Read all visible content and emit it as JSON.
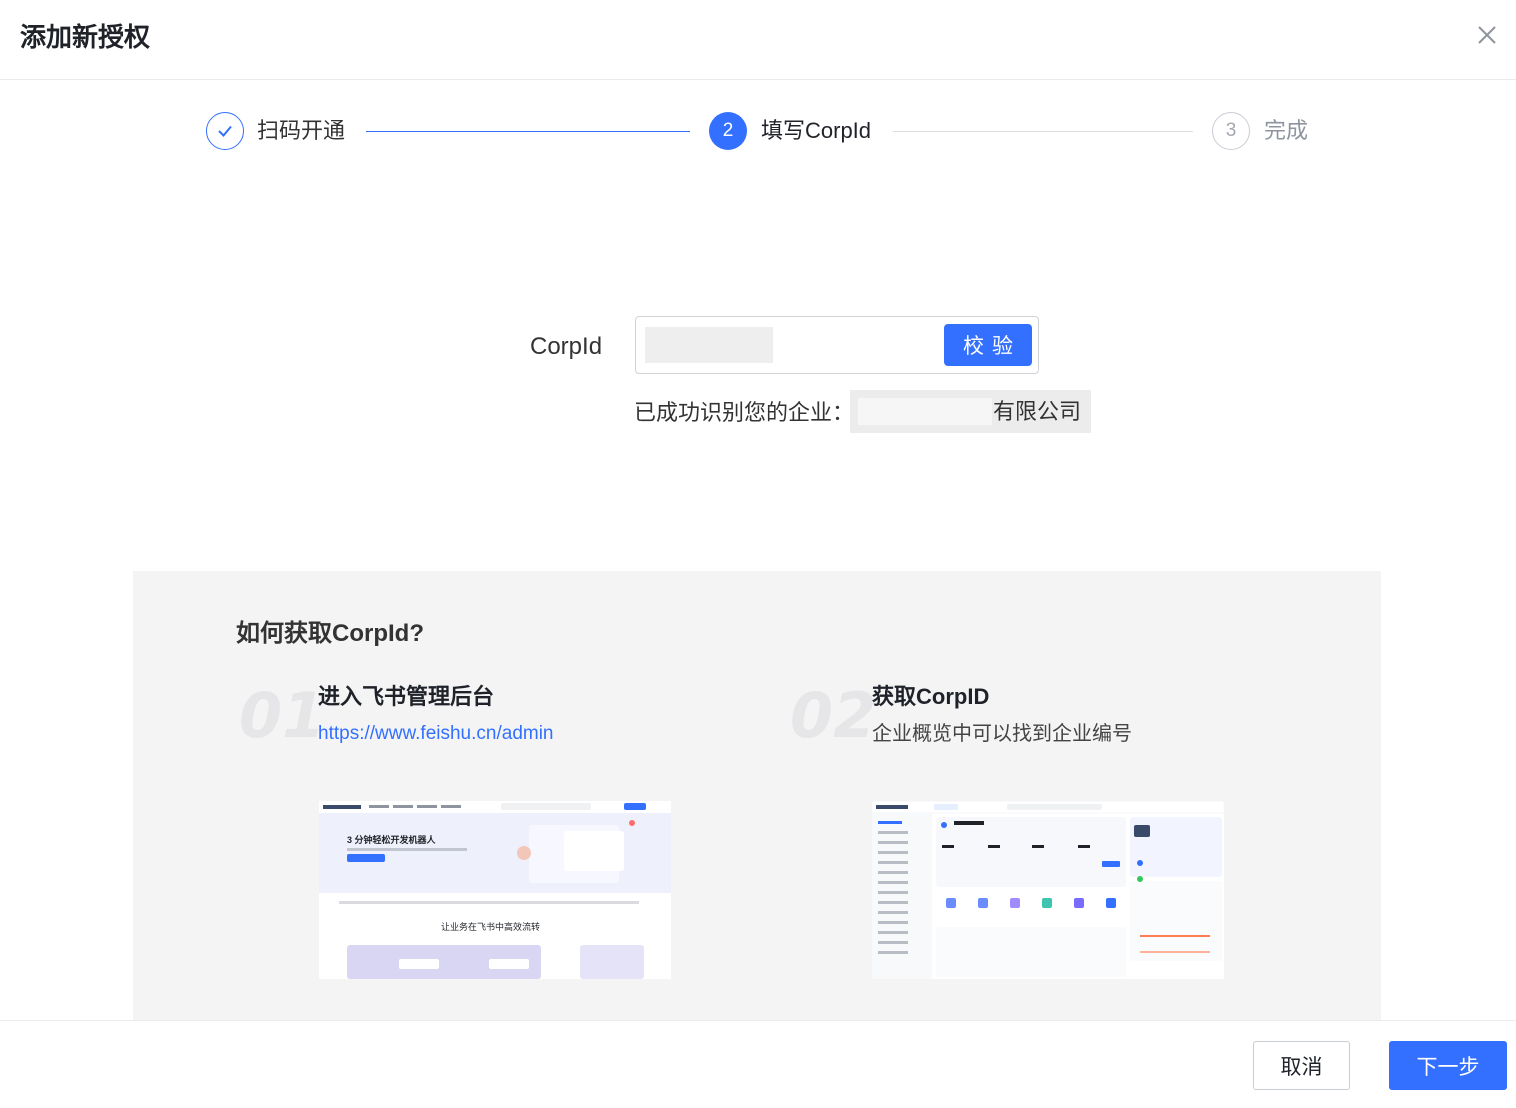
{
  "dialog": {
    "title": "添加新授权"
  },
  "steps": [
    {
      "label": "扫码开通",
      "status": "done"
    },
    {
      "number": "2",
      "label": "填写CorpId",
      "status": "active"
    },
    {
      "number": "3",
      "label": "完成",
      "status": "pending"
    }
  ],
  "form": {
    "corp_label": "CorpId",
    "input_value": "",
    "verify_label": "校验",
    "success_text": "已成功识别您的企业：",
    "company_suffix": "有限公司"
  },
  "help": {
    "title": "如何获取CorpId?",
    "items": [
      {
        "number": "01",
        "title": "进入飞书管理后台",
        "link": "https://www.feishu.cn/admin"
      },
      {
        "number": "02",
        "title": "获取CorpID",
        "desc": "企业概览中可以找到企业编号"
      }
    ],
    "thumb1": {
      "headline": "3 分钟轻松开发机器人",
      "subhead": "让业务在飞书中高效流转"
    }
  },
  "footer": {
    "cancel_label": "取消",
    "next_label": "下一步"
  },
  "colors": {
    "primary": "#3370ff",
    "panel_bg": "#f4f4f5"
  }
}
